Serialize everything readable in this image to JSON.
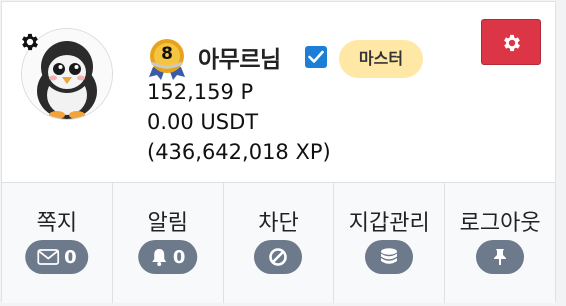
{
  "profile": {
    "username": "아무르님",
    "level": "8",
    "grade": "마스터",
    "points": "152,159 P",
    "usdt": "0.00 USDT",
    "xp": "(436,642,018 XP)"
  },
  "menu": {
    "message": {
      "label": "쪽지",
      "count": "0",
      "icon": "envelope-icon"
    },
    "notification": {
      "label": "알림",
      "count": "0",
      "icon": "bell-icon"
    },
    "block": {
      "label": "차단",
      "icon": "ban-icon"
    },
    "wallet": {
      "label": "지갑관리",
      "icon": "coins-icon"
    },
    "logout": {
      "label": "로그아웃",
      "icon": "pin-icon"
    }
  },
  "colors": {
    "settings_button": "#dc3545",
    "grade_badge": "#ffe8a6",
    "verified": "#1c7ed6",
    "menu_pill": "#6c7a8c"
  }
}
